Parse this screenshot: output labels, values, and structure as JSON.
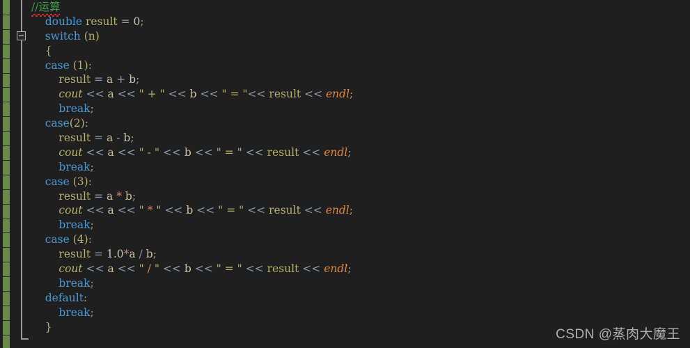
{
  "editor": {
    "theme": "dark",
    "background_color": "#1f1f1f",
    "change_bar_color": "#6a8a47",
    "fold_line_color": "#9a9a9a",
    "line_height_px": 20.9,
    "font_size_px": 15.5
  },
  "colors": {
    "comment": "#3f9e4d",
    "keyword": "#4a9ad4",
    "identifier": "#b5b06a",
    "number": "#b5cea8",
    "operator": "#8f9aa5",
    "string": "#b5b06a",
    "endl": "#e2873c",
    "punctuation": "#9a9a8a",
    "error_squiggle": "#d03030",
    "watermark": "#cfcfcf"
  },
  "gutter": {
    "fold_toggle": {
      "name": "collapse-switch-block",
      "state": "expanded",
      "glyph": "−"
    }
  },
  "code_lines": [
    {
      "indent": 0,
      "tokens": [
        {
          "t": "//运算",
          "c": "comment",
          "squiggle": true
        }
      ]
    },
    {
      "indent": 1,
      "tokens": [
        {
          "t": "double",
          "c": "keyword"
        },
        {
          "t": " ",
          "c": "plain"
        },
        {
          "t": "result",
          "c": "ident"
        },
        {
          "t": " ",
          "c": "plain"
        },
        {
          "t": "=",
          "c": "op"
        },
        {
          "t": " ",
          "c": "plain"
        },
        {
          "t": "0",
          "c": "num"
        },
        {
          "t": ";",
          "c": "punct"
        }
      ]
    },
    {
      "indent": 1,
      "tokens": [
        {
          "t": "switch",
          "c": "keyword"
        },
        {
          "t": " ",
          "c": "plain"
        },
        {
          "t": "(n)",
          "c": "paren"
        }
      ]
    },
    {
      "indent": 1,
      "tokens": [
        {
          "t": "{",
          "c": "brace"
        }
      ]
    },
    {
      "indent": 1,
      "tokens": [
        {
          "t": "case",
          "c": "keyword"
        },
        {
          "t": " ",
          "c": "plain"
        },
        {
          "t": "(1)",
          "c": "paren"
        },
        {
          "t": ":",
          "c": "punct"
        }
      ]
    },
    {
      "indent": 2,
      "tokens": [
        {
          "t": "result",
          "c": "ident"
        },
        {
          "t": " ",
          "c": "plain"
        },
        {
          "t": "=",
          "c": "op"
        },
        {
          "t": " ",
          "c": "plain"
        },
        {
          "t": "a",
          "c": "var"
        },
        {
          "t": " ",
          "c": "plain"
        },
        {
          "t": "+",
          "c": "op"
        },
        {
          "t": " ",
          "c": "plain"
        },
        {
          "t": "b",
          "c": "var"
        },
        {
          "t": ";",
          "c": "punct"
        }
      ]
    },
    {
      "indent": 2,
      "tokens": [
        {
          "t": "cout",
          "c": "obj"
        },
        {
          "t": " ",
          "c": "plain"
        },
        {
          "t": "<<",
          "c": "op"
        },
        {
          "t": " ",
          "c": "plain"
        },
        {
          "t": "a",
          "c": "var"
        },
        {
          "t": " ",
          "c": "plain"
        },
        {
          "t": "<<",
          "c": "op"
        },
        {
          "t": " ",
          "c": "plain"
        },
        {
          "t": "\" + \"",
          "c": "string"
        },
        {
          "t": " ",
          "c": "plain"
        },
        {
          "t": "<<",
          "c": "op"
        },
        {
          "t": " ",
          "c": "plain"
        },
        {
          "t": "b",
          "c": "var"
        },
        {
          "t": " ",
          "c": "plain"
        },
        {
          "t": "<<",
          "c": "op"
        },
        {
          "t": " ",
          "c": "plain"
        },
        {
          "t": "\" = \"",
          "c": "string"
        },
        {
          "t": "<<",
          "c": "op"
        },
        {
          "t": " ",
          "c": "plain"
        },
        {
          "t": "result",
          "c": "ident"
        },
        {
          "t": " ",
          "c": "plain"
        },
        {
          "t": "<<",
          "c": "op"
        },
        {
          "t": " ",
          "c": "plain"
        },
        {
          "t": "endl",
          "c": "endl"
        },
        {
          "t": ";",
          "c": "punct"
        }
      ]
    },
    {
      "indent": 2,
      "tokens": [
        {
          "t": "break",
          "c": "keyword"
        },
        {
          "t": ";",
          "c": "punct"
        }
      ]
    },
    {
      "indent": 1,
      "tokens": [
        {
          "t": "case",
          "c": "keyword"
        },
        {
          "t": "(2)",
          "c": "paren"
        },
        {
          "t": ":",
          "c": "punct"
        }
      ]
    },
    {
      "indent": 2,
      "tokens": [
        {
          "t": "result",
          "c": "ident"
        },
        {
          "t": " ",
          "c": "plain"
        },
        {
          "t": "=",
          "c": "op"
        },
        {
          "t": " ",
          "c": "plain"
        },
        {
          "t": "a",
          "c": "var"
        },
        {
          "t": " ",
          "c": "plain"
        },
        {
          "t": "-",
          "c": "op"
        },
        {
          "t": " ",
          "c": "plain"
        },
        {
          "t": "b",
          "c": "var"
        },
        {
          "t": ";",
          "c": "punct"
        }
      ]
    },
    {
      "indent": 2,
      "tokens": [
        {
          "t": "cout",
          "c": "obj"
        },
        {
          "t": " ",
          "c": "plain"
        },
        {
          "t": "<<",
          "c": "op"
        },
        {
          "t": " ",
          "c": "plain"
        },
        {
          "t": "a",
          "c": "var"
        },
        {
          "t": " ",
          "c": "plain"
        },
        {
          "t": "<<",
          "c": "op"
        },
        {
          "t": " ",
          "c": "plain"
        },
        {
          "t": "\" - \"",
          "c": "string"
        },
        {
          "t": " ",
          "c": "plain"
        },
        {
          "t": "<<",
          "c": "op"
        },
        {
          "t": " ",
          "c": "plain"
        },
        {
          "t": "b",
          "c": "var"
        },
        {
          "t": " ",
          "c": "plain"
        },
        {
          "t": "<<",
          "c": "op"
        },
        {
          "t": " ",
          "c": "plain"
        },
        {
          "t": "\" = \"",
          "c": "string"
        },
        {
          "t": " ",
          "c": "plain"
        },
        {
          "t": "<<",
          "c": "op"
        },
        {
          "t": " ",
          "c": "plain"
        },
        {
          "t": "result",
          "c": "ident"
        },
        {
          "t": " ",
          "c": "plain"
        },
        {
          "t": "<<",
          "c": "op"
        },
        {
          "t": " ",
          "c": "plain"
        },
        {
          "t": "endl",
          "c": "endl"
        },
        {
          "t": ";",
          "c": "punct"
        }
      ]
    },
    {
      "indent": 2,
      "tokens": [
        {
          "t": "break",
          "c": "keyword"
        },
        {
          "t": ";",
          "c": "punct"
        }
      ]
    },
    {
      "indent": 1,
      "tokens": [
        {
          "t": "case",
          "c": "keyword"
        },
        {
          "t": " ",
          "c": "plain"
        },
        {
          "t": "(3)",
          "c": "paren"
        },
        {
          "t": ":",
          "c": "punct"
        }
      ]
    },
    {
      "indent": 2,
      "tokens": [
        {
          "t": "result",
          "c": "ident"
        },
        {
          "t": " ",
          "c": "plain"
        },
        {
          "t": "=",
          "c": "op"
        },
        {
          "t": " ",
          "c": "plain"
        },
        {
          "t": "a",
          "c": "var"
        },
        {
          "t": " ",
          "c": "plain"
        },
        {
          "t": "*",
          "c": "strop"
        },
        {
          "t": " ",
          "c": "plain"
        },
        {
          "t": "b",
          "c": "var"
        },
        {
          "t": ";",
          "c": "punct"
        }
      ]
    },
    {
      "indent": 2,
      "tokens": [
        {
          "t": "cout",
          "c": "obj"
        },
        {
          "t": " ",
          "c": "plain"
        },
        {
          "t": "<<",
          "c": "op"
        },
        {
          "t": " ",
          "c": "plain"
        },
        {
          "t": "a",
          "c": "var"
        },
        {
          "t": " ",
          "c": "plain"
        },
        {
          "t": "<<",
          "c": "op"
        },
        {
          "t": " ",
          "c": "plain"
        },
        {
          "t": "\" ",
          "c": "string"
        },
        {
          "t": "*",
          "c": "strop"
        },
        {
          "t": " \"",
          "c": "string"
        },
        {
          "t": " ",
          "c": "plain"
        },
        {
          "t": "<<",
          "c": "op"
        },
        {
          "t": " ",
          "c": "plain"
        },
        {
          "t": "b",
          "c": "var"
        },
        {
          "t": " ",
          "c": "plain"
        },
        {
          "t": "<<",
          "c": "op"
        },
        {
          "t": " ",
          "c": "plain"
        },
        {
          "t": "\" = \"",
          "c": "string"
        },
        {
          "t": " ",
          "c": "plain"
        },
        {
          "t": "<<",
          "c": "op"
        },
        {
          "t": " ",
          "c": "plain"
        },
        {
          "t": "result",
          "c": "ident"
        },
        {
          "t": " ",
          "c": "plain"
        },
        {
          "t": "<<",
          "c": "op"
        },
        {
          "t": " ",
          "c": "plain"
        },
        {
          "t": "endl",
          "c": "endl"
        },
        {
          "t": ";",
          "c": "punct"
        }
      ]
    },
    {
      "indent": 2,
      "tokens": [
        {
          "t": "break",
          "c": "keyword"
        },
        {
          "t": ";",
          "c": "punct"
        }
      ]
    },
    {
      "indent": 1,
      "tokens": [
        {
          "t": "case",
          "c": "keyword"
        },
        {
          "t": " ",
          "c": "plain"
        },
        {
          "t": "(4)",
          "c": "paren"
        },
        {
          "t": ":",
          "c": "punct"
        }
      ]
    },
    {
      "indent": 2,
      "tokens": [
        {
          "t": "result",
          "c": "ident"
        },
        {
          "t": " ",
          "c": "plain"
        },
        {
          "t": "=",
          "c": "op"
        },
        {
          "t": " ",
          "c": "plain"
        },
        {
          "t": "1.0",
          "c": "num"
        },
        {
          "t": "*",
          "c": "strop"
        },
        {
          "t": "a",
          "c": "var"
        },
        {
          "t": " ",
          "c": "plain"
        },
        {
          "t": "/",
          "c": "op"
        },
        {
          "t": " ",
          "c": "plain"
        },
        {
          "t": "b",
          "c": "var"
        },
        {
          "t": ";",
          "c": "punct"
        }
      ]
    },
    {
      "indent": 2,
      "tokens": [
        {
          "t": "cout",
          "c": "obj"
        },
        {
          "t": " ",
          "c": "plain"
        },
        {
          "t": "<<",
          "c": "op"
        },
        {
          "t": " ",
          "c": "plain"
        },
        {
          "t": "a",
          "c": "var"
        },
        {
          "t": " ",
          "c": "plain"
        },
        {
          "t": "<<",
          "c": "op"
        },
        {
          "t": " ",
          "c": "plain"
        },
        {
          "t": "\" ",
          "c": "string"
        },
        {
          "t": "/",
          "c": "strop"
        },
        {
          "t": " \"",
          "c": "string"
        },
        {
          "t": " ",
          "c": "plain"
        },
        {
          "t": "<<",
          "c": "op"
        },
        {
          "t": " ",
          "c": "plain"
        },
        {
          "t": "b",
          "c": "var"
        },
        {
          "t": " ",
          "c": "plain"
        },
        {
          "t": "<<",
          "c": "op"
        },
        {
          "t": " ",
          "c": "plain"
        },
        {
          "t": "\" = \"",
          "c": "string"
        },
        {
          "t": " ",
          "c": "plain"
        },
        {
          "t": "<<",
          "c": "op"
        },
        {
          "t": " ",
          "c": "plain"
        },
        {
          "t": "result",
          "c": "ident"
        },
        {
          "t": " ",
          "c": "plain"
        },
        {
          "t": "<<",
          "c": "op"
        },
        {
          "t": " ",
          "c": "plain"
        },
        {
          "t": "endl",
          "c": "endl"
        },
        {
          "t": ";",
          "c": "punct"
        }
      ]
    },
    {
      "indent": 2,
      "tokens": [
        {
          "t": "break",
          "c": "keyword"
        },
        {
          "t": ";",
          "c": "punct"
        }
      ]
    },
    {
      "indent": 1,
      "tokens": [
        {
          "t": "default",
          "c": "keyword"
        },
        {
          "t": ":",
          "c": "punct"
        }
      ]
    },
    {
      "indent": 2,
      "tokens": [
        {
          "t": "break",
          "c": "keyword"
        },
        {
          "t": ";",
          "c": "punct"
        }
      ]
    },
    {
      "indent": 1,
      "tokens": [
        {
          "t": "}",
          "c": "brace"
        }
      ]
    }
  ],
  "watermark": {
    "text": "CSDN @蒸肉大魔王"
  }
}
